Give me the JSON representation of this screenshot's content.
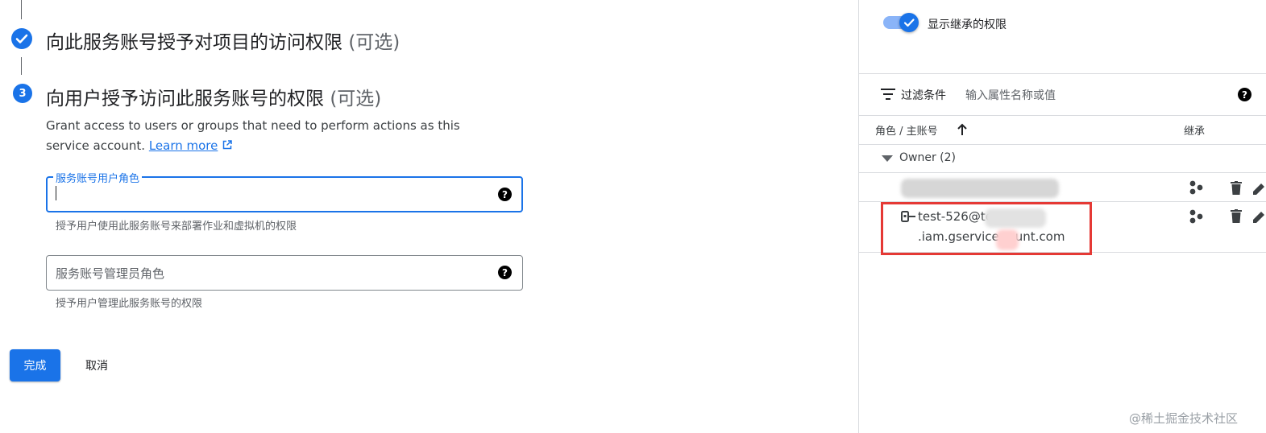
{
  "steps": {
    "step2": {
      "title": "向此服务账号授予对项目的访问权限",
      "optional": "(可选)"
    },
    "step3": {
      "number": "3",
      "title": "向用户授予访问此服务账号的权限",
      "optional": "(可选)",
      "description": "Grant access to users or groups that need to perform actions as this service account.",
      "learn_more": "Learn more"
    }
  },
  "fields": {
    "user_role": {
      "label": "服务账号用户角色",
      "value": "",
      "hint": "授予用户使用此服务账号来部署作业和虚拟机的权限"
    },
    "admin_role": {
      "placeholder": "服务账号管理员角色",
      "hint": "授予用户管理此服务账号的权限"
    }
  },
  "actions": {
    "done": "完成",
    "cancel": "取消"
  },
  "right_panel": {
    "show_inherited": {
      "label": "显示继承的权限",
      "enabled": true
    },
    "filter": {
      "label": "过滤条件",
      "placeholder": "输入属性名称或值"
    },
    "table": {
      "headers": {
        "role_principal": "角色 / 主账号",
        "inherited": "继承"
      },
      "group": {
        "label": "Owner (2)"
      },
      "rows": [
        {
          "line1": "",
          "line2": ""
        },
        {
          "line1": "test-526@te",
          "line2": ".iam.gservice",
          "line2_end": "unt.com"
        }
      ]
    }
  },
  "watermark": "@稀土掘金技术社区",
  "colors": {
    "accent": "#1a73e8",
    "highlight": "#e53935"
  }
}
